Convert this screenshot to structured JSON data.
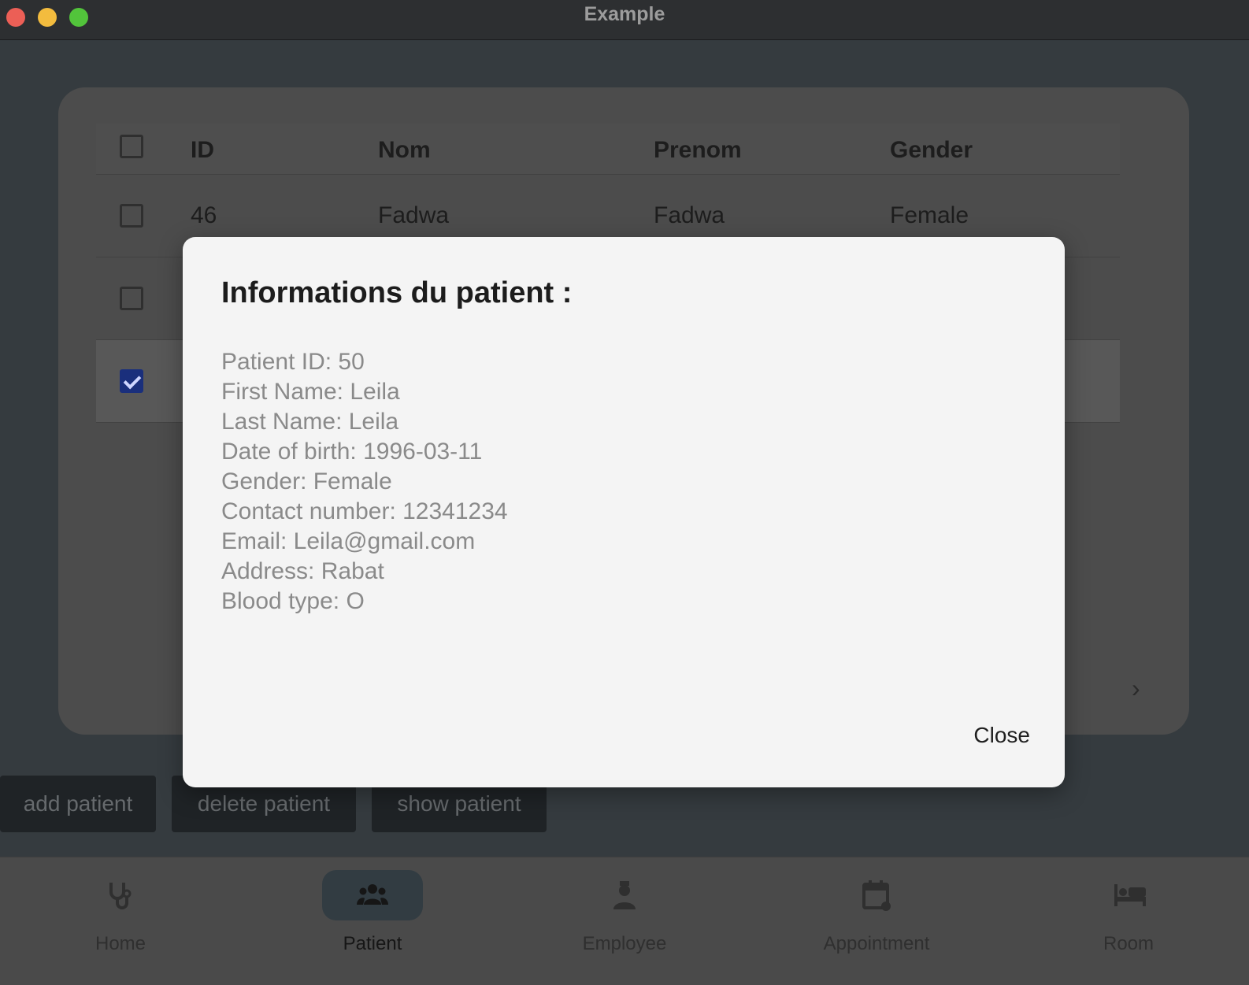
{
  "window": {
    "title": "Example"
  },
  "table": {
    "headers": {
      "id": "ID",
      "nom": "Nom",
      "prenom": "Prenom",
      "gender": "Gender"
    },
    "rows": [
      {
        "id": "46",
        "nom": "Fadwa",
        "prenom": "Fadwa",
        "gender": "Female",
        "checked": false
      },
      {
        "id": "",
        "nom": "",
        "prenom": "",
        "gender": "",
        "checked": false
      },
      {
        "id": "",
        "nom": "",
        "prenom": "",
        "gender": "",
        "checked": true
      }
    ]
  },
  "actions": {
    "add": "add patient",
    "delete": "delete patient",
    "show": "show patient"
  },
  "nav": {
    "items": [
      {
        "label": "Home",
        "icon": "stethoscope-icon"
      },
      {
        "label": "Patient",
        "icon": "group-icon",
        "active": true
      },
      {
        "label": "Employee",
        "icon": "doctor-icon"
      },
      {
        "label": "Appointment",
        "icon": "calendar-icon"
      },
      {
        "label": "Room",
        "icon": "bed-icon"
      }
    ]
  },
  "dialog": {
    "title": "Informations du patient :",
    "lines": [
      "Patient ID: 50",
      "First Name: Leila",
      "Last Name: Leila",
      "Date of birth: 1996-03-11",
      "Gender: Female",
      "Contact number: 12341234",
      "Email: Leila@gmail.com",
      "Address: Rabat",
      "Blood type: O"
    ],
    "close": "Close"
  }
}
